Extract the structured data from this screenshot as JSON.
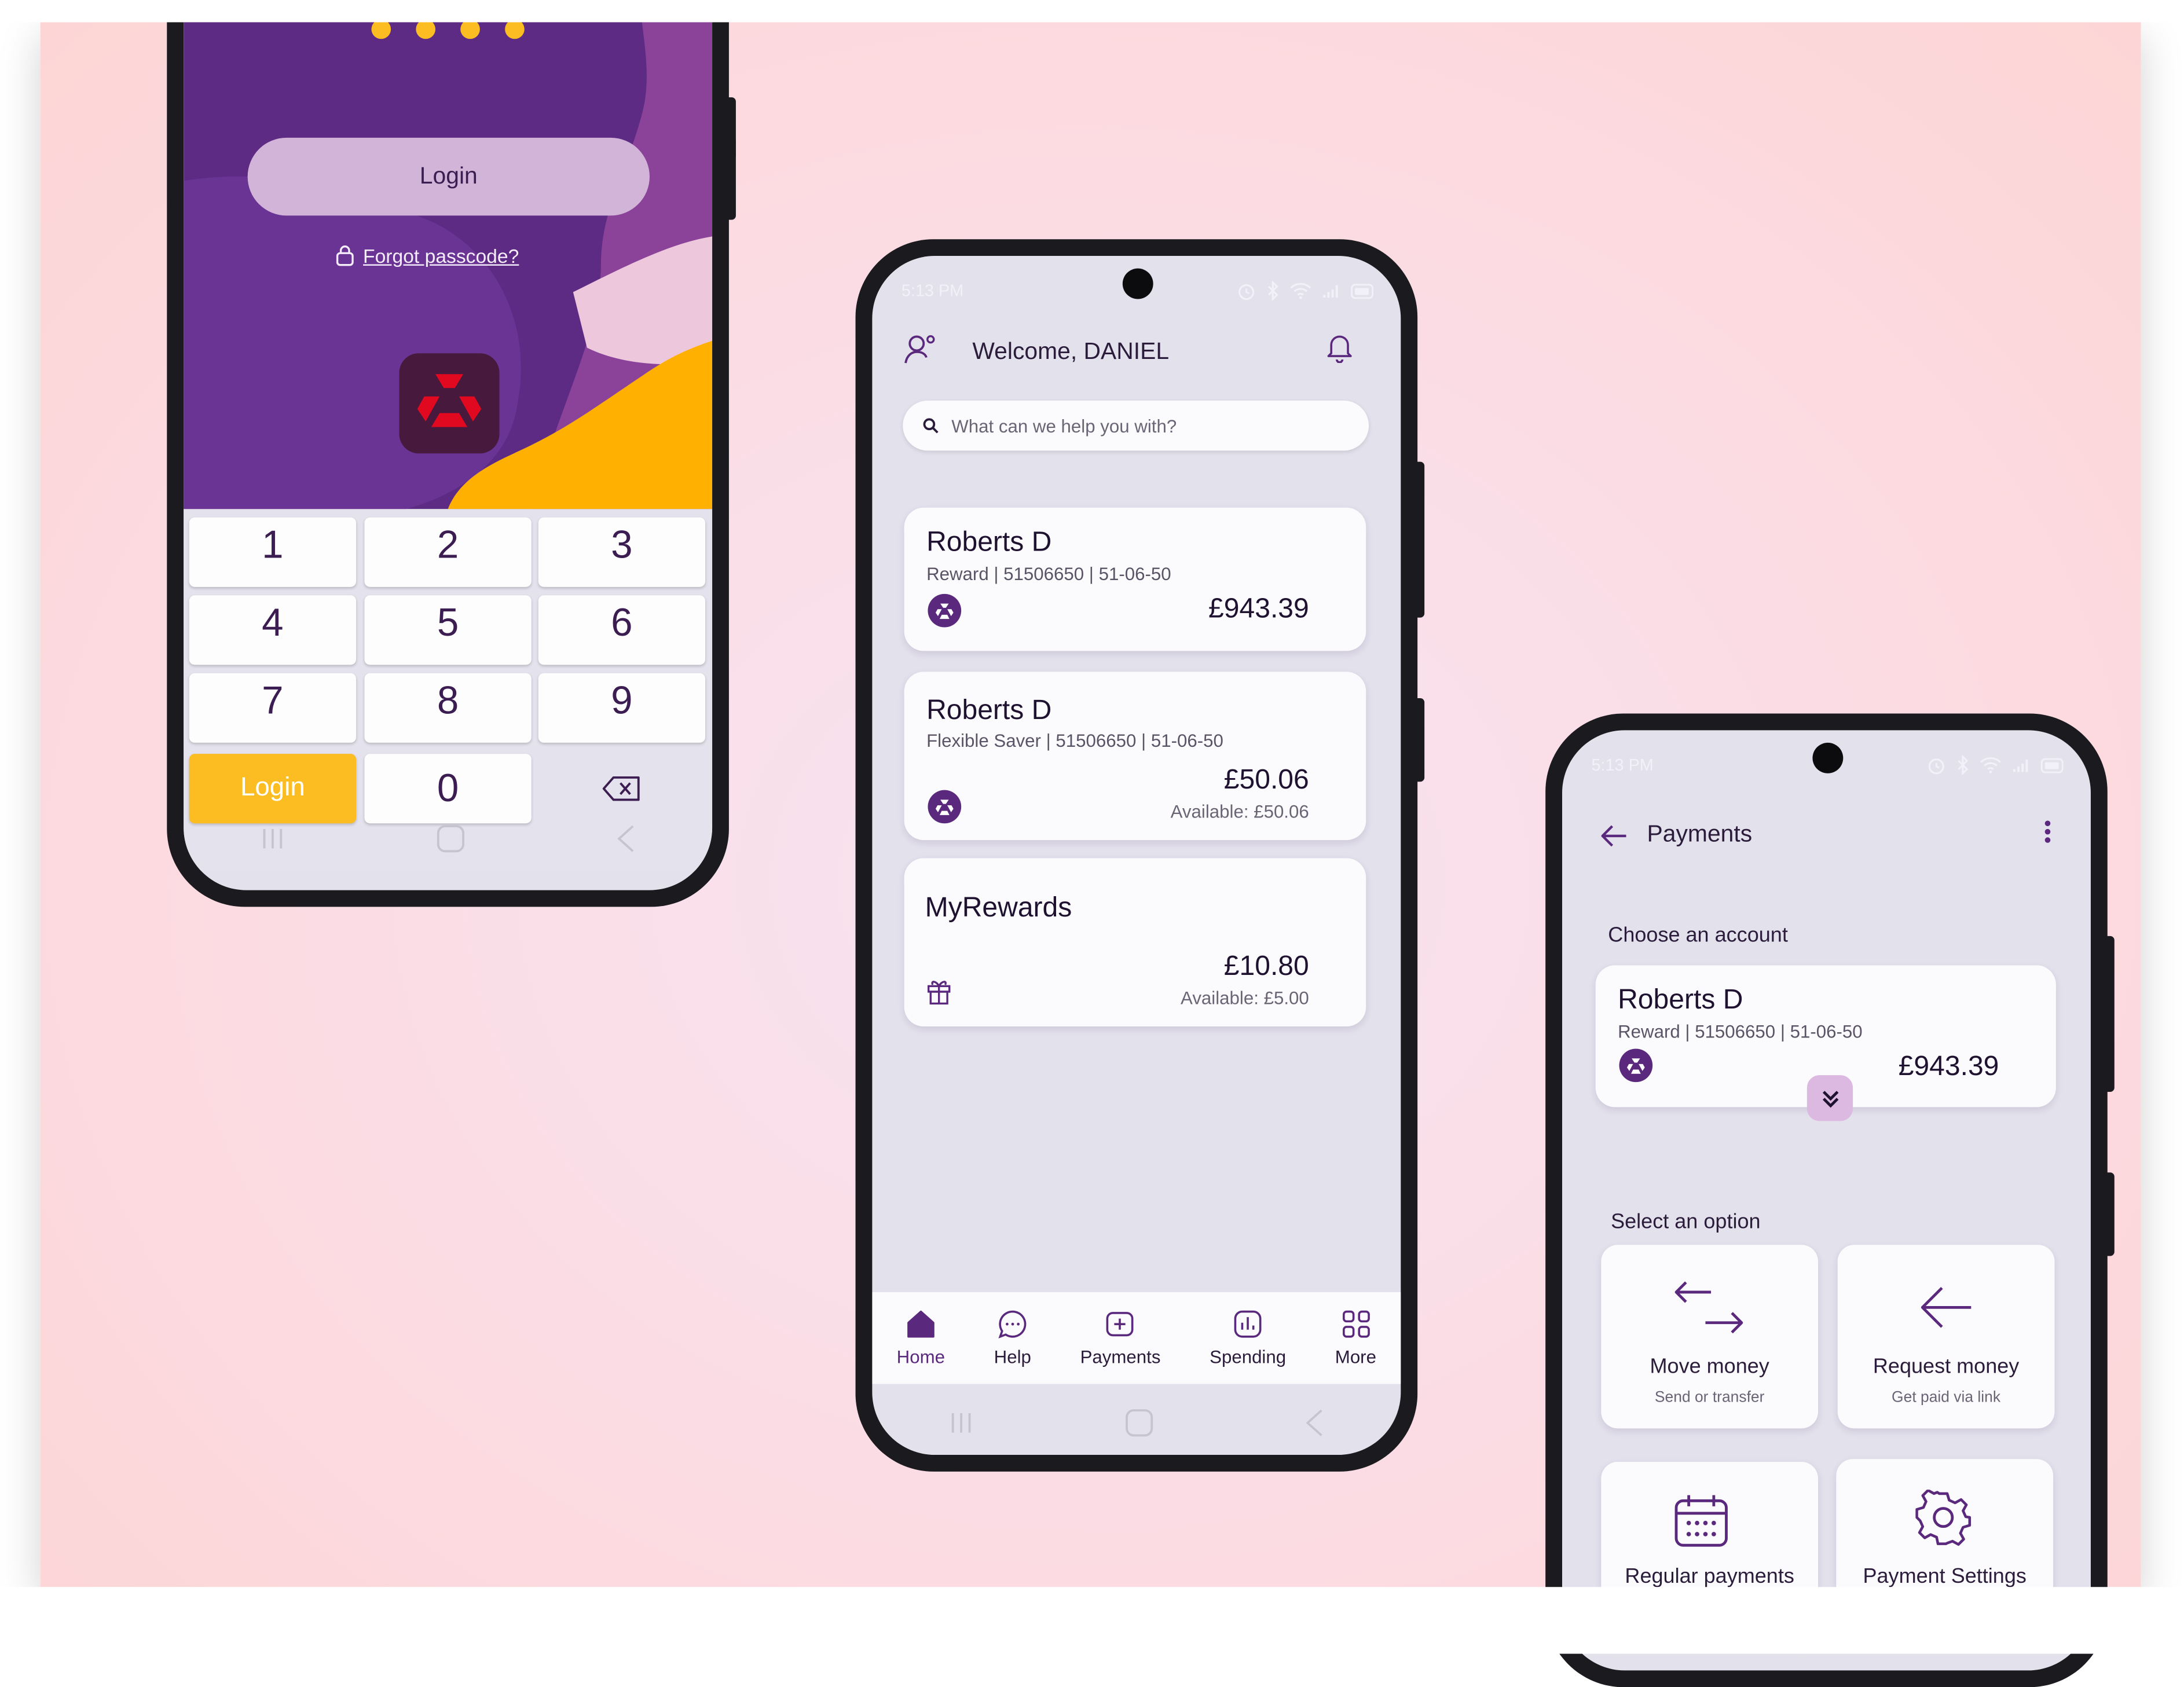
{
  "login_screen": {
    "passcode_dots": 4,
    "login_button": "Login",
    "forgot_passcode": "Forgot passcode?",
    "keys": [
      "1",
      "2",
      "3",
      "4",
      "5",
      "6",
      "7",
      "8",
      "9"
    ],
    "zero_key": "0",
    "keypad_login": "Login",
    "colors": {
      "purple": "#5a287d",
      "yellow": "#ffb800",
      "pink": "#edc7dc",
      "keypad_login": "#fbbd22"
    }
  },
  "home_screen": {
    "status_time": "5:13 PM",
    "welcome": "Welcome, DANIEL",
    "search_placeholder": "What can we help you with?",
    "accounts": [
      {
        "name": "Roberts D",
        "details": "Reward | 51506650 | 51-06-50",
        "balance": "£943.39"
      },
      {
        "name": "Roberts D",
        "details": "Flexible Saver | 51506650 | 51-06-50",
        "balance": "£50.06",
        "available": "Available: £50.06"
      }
    ],
    "rewards": {
      "name": "MyRewards",
      "balance": "£10.80",
      "available": "Available: £5.00"
    },
    "tabs": [
      {
        "label": "Home",
        "icon": "home-icon",
        "active": true
      },
      {
        "label": "Help",
        "icon": "chat-icon",
        "active": false
      },
      {
        "label": "Payments",
        "icon": "payments-icon",
        "active": false
      },
      {
        "label": "Spending",
        "icon": "spending-icon",
        "active": false
      },
      {
        "label": "More",
        "icon": "grid-icon",
        "active": false
      }
    ]
  },
  "payments_screen": {
    "status_time": "5:13 PM",
    "title": "Payments",
    "choose_account": "Choose an account",
    "account": {
      "name": "Roberts D",
      "details": "Reward | 51506650 | 51-06-50",
      "balance": "£943.39"
    },
    "select_option": "Select an option",
    "options": [
      {
        "label": "Move money",
        "sub": "Send or transfer",
        "icon": "move-money-icon"
      },
      {
        "label": "Request money",
        "sub": "Get paid via link",
        "icon": "request-money-icon"
      },
      {
        "label": "Regular payments",
        "icon": "calendar-icon"
      },
      {
        "label": "Payment Settings",
        "icon": "gear-icon"
      }
    ]
  }
}
